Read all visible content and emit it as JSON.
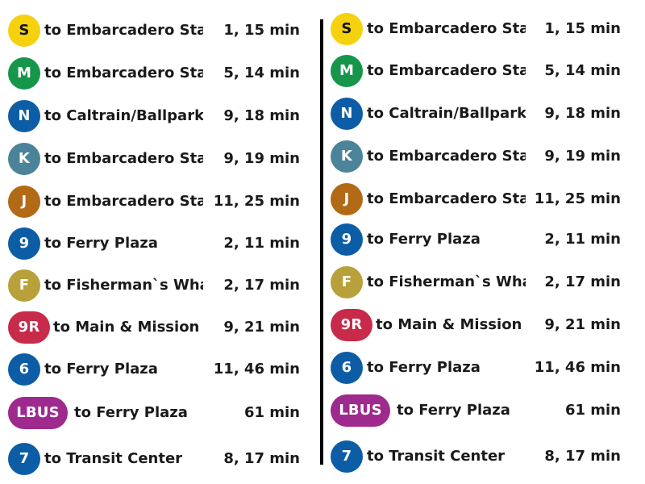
{
  "panels": [
    {
      "rows": [
        {
          "badge": "S",
          "color": "#f5d20d",
          "dest": "to Embarcadero Stat",
          "times": "1, 15 min"
        },
        {
          "badge": "M",
          "color": "#16964a",
          "dest": "to Embarcadero Stat",
          "times": "5, 14 min"
        },
        {
          "badge": "N",
          "color": "#0c5da5",
          "dest": "to Caltrain/Ballpark",
          "times": "9, 18 min"
        },
        {
          "badge": "K",
          "color": "#4b8499",
          "dest": "to Embarcadero Stat",
          "times": "9, 19 min"
        },
        {
          "badge": "J",
          "color": "#b26a16",
          "dest": "to Embarcadero Stat",
          "times": "11, 25 min"
        },
        {
          "badge": "9",
          "color": "#0c5da5",
          "dest": "to Ferry Plaza",
          "times": "2, 11 min"
        },
        {
          "badge": "F",
          "color": "#b8a13a",
          "dest": "to Fisherman`s Whar",
          "times": "2, 17 min"
        },
        {
          "badge": "9R",
          "color": "#c82a4a",
          "dest": "to Main & Mission",
          "times": "9, 21 min"
        },
        {
          "badge": "6",
          "color": "#0c5da5",
          "dest": "to Ferry Plaza",
          "times": "11, 46 min"
        },
        {
          "badge": "LBUS",
          "color": "#9e2a8e",
          "dest": "to Ferry Plaza",
          "times": "61 min"
        },
        {
          "badge": "7",
          "color": "#0c5da5",
          "dest": "to Transit Center",
          "times": "8, 17 min"
        }
      ]
    },
    {
      "rows": [
        {
          "badge": "S",
          "color": "#f5d20d",
          "dest": "to Embarcadero Stat",
          "times": "1, 15 min"
        },
        {
          "badge": "M",
          "color": "#16964a",
          "dest": "to Embarcadero Stat",
          "times": "5, 14 min"
        },
        {
          "badge": "N",
          "color": "#0c5da5",
          "dest": "to Caltrain/Ballpark",
          "times": "9, 18 min"
        },
        {
          "badge": "K",
          "color": "#4b8499",
          "dest": "to Embarcadero Stat",
          "times": "9, 19 min"
        },
        {
          "badge": "J",
          "color": "#b26a16",
          "dest": "to Embarcadero Stat",
          "times": "11, 25 min"
        },
        {
          "badge": "9",
          "color": "#0c5da5",
          "dest": "to Ferry Plaza",
          "times": "2, 11 min"
        },
        {
          "badge": "F",
          "color": "#b8a13a",
          "dest": "to Fisherman`s Whar",
          "times": "2, 17 min"
        },
        {
          "badge": "9R",
          "color": "#c82a4a",
          "dest": "to Main & Mission",
          "times": "9, 21 min"
        },
        {
          "badge": "6",
          "color": "#0c5da5",
          "dest": "to Ferry Plaza",
          "times": "11, 46 min"
        },
        {
          "badge": "LBUS",
          "color": "#9e2a8e",
          "dest": "to Ferry Plaza",
          "times": "61 min"
        },
        {
          "badge": "7",
          "color": "#0c5da5",
          "dest": "to Transit Center",
          "times": "8, 17 min"
        }
      ]
    }
  ]
}
